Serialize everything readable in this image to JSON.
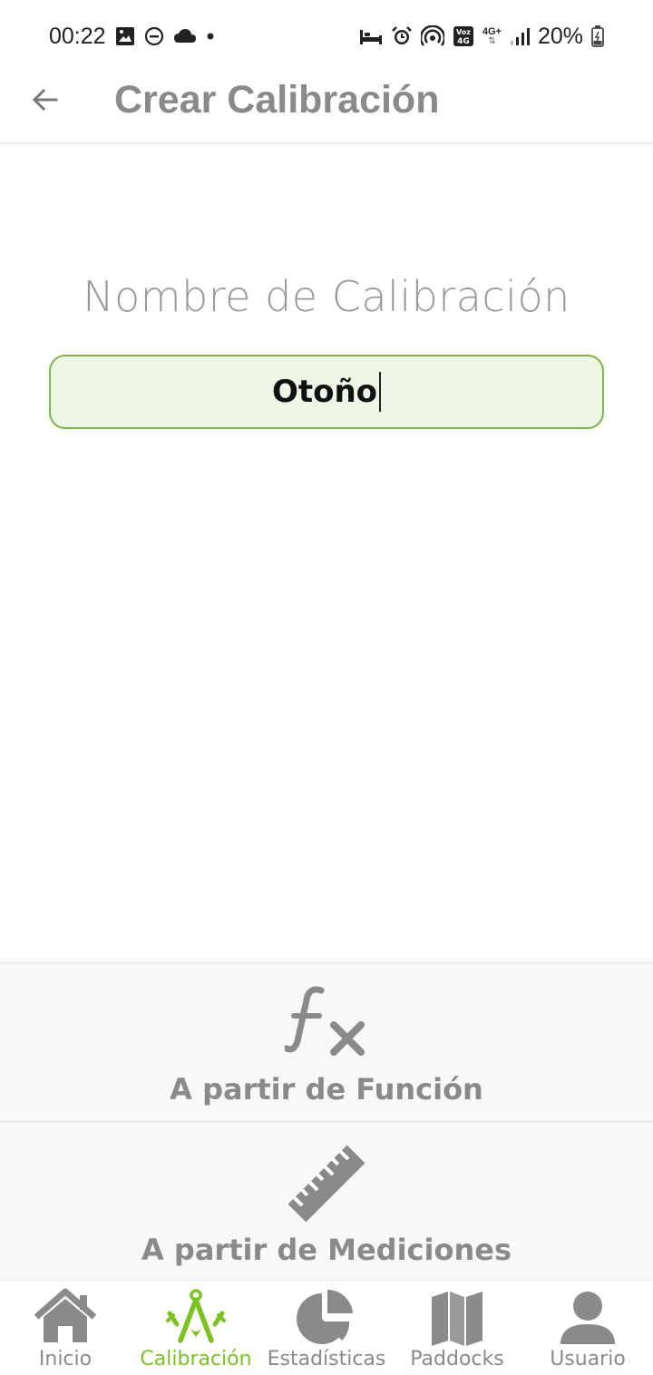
{
  "status_bar": {
    "time": "00:22",
    "battery": "20%",
    "network": "4G+",
    "volte": "Voz 4G",
    "left_icons": [
      "image-icon",
      "do-not-disturb-icon",
      "cloud-icon",
      "dot-icon"
    ],
    "right_icons": [
      "bed-icon",
      "alarm-icon",
      "hotspot-icon",
      "volte-icon",
      "network-4g-icon",
      "signal-icon",
      "battery-icon"
    ]
  },
  "app_bar": {
    "title": "Crear Calibración",
    "back_icon": "arrow-left-icon"
  },
  "form": {
    "label": "Nombre de Calibración",
    "value": "Otoño"
  },
  "options": [
    {
      "label": "A partir de Función",
      "icon": "function-fx-icon"
    },
    {
      "label": "A partir de Mediciones",
      "icon": "ruler-icon"
    }
  ],
  "bottom_nav": [
    {
      "label": "Inicio",
      "icon": "home-icon",
      "active": false
    },
    {
      "label": "Calibración",
      "icon": "compass-icon",
      "active": true
    },
    {
      "label": "Estadísticas",
      "icon": "pie-chart-icon",
      "active": false
    },
    {
      "label": "Paddocks",
      "icon": "map-icon",
      "active": false
    },
    {
      "label": "Usuario",
      "icon": "user-icon",
      "active": false
    }
  ],
  "colors": {
    "accent": "#7ac31f",
    "input_bg": "#eef6e6",
    "input_border": "#7ab648",
    "muted_text": "#8a8a8a"
  }
}
